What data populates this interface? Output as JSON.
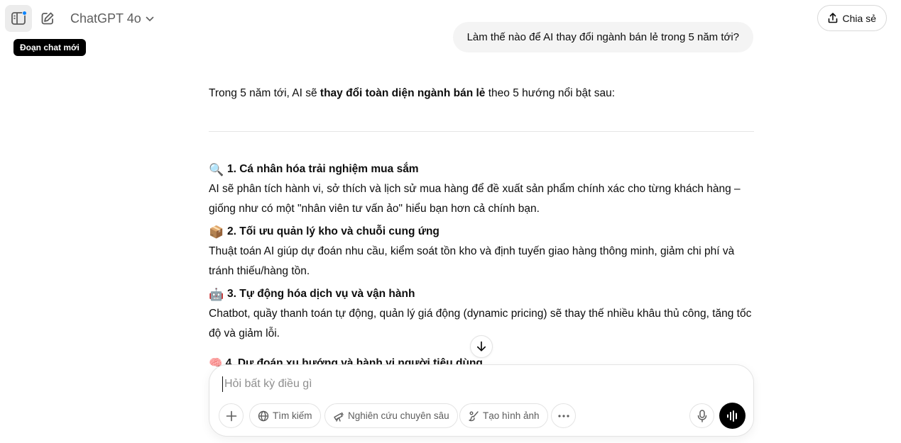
{
  "header": {
    "model_name": "ChatGPT 4o",
    "tooltip": "Đoạn chat mới",
    "share_label": "Chia sẻ"
  },
  "conversation": {
    "user_message": "Làm thế nào để AI thay đổi ngành bán lẻ trong 5 năm tới?",
    "intro_before": "Trong 5 năm tới, AI sẽ ",
    "intro_bold": "thay đổi toàn diện ngành bán lẻ",
    "intro_after": " theo 5 hướng nổi bật sau:",
    "sections": [
      {
        "icon": "🔍",
        "title": "1. Cá nhân hóa trải nghiệm mua sắm",
        "body": "AI sẽ phân tích hành vi, sở thích và lịch sử mua hàng để đề xuất sản phẩm chính xác cho từng khách hàng – giống như có một \"nhân viên tư vấn ảo\" hiểu bạn hơn cả chính bạn."
      },
      {
        "icon": "📦",
        "title": "2. Tối ưu quản lý kho và chuỗi cung ứng",
        "body": "Thuật toán AI giúp dự đoán nhu cầu, kiểm soát tồn kho và định tuyến giao hàng thông minh, giảm chi phí và tránh thiếu/hàng tồn."
      },
      {
        "icon": "🤖",
        "title": "3. Tự động hóa dịch vụ và vận hành",
        "body": "Chatbot, quầy thanh toán tự động, quản lý giá động (dynamic pricing) sẽ thay thế nhiều khâu thủ công, tăng tốc độ và giảm lỗi."
      }
    ],
    "partial_next": "🧠 4. Dự đoán xu hướng và hành vi người tiêu dùng"
  },
  "composer": {
    "placeholder": "Hỏi bất kỳ điều gì",
    "search_label": "Tìm kiếm",
    "research_label": "Nghiên cứu chuyên sâu",
    "image_label": "Tạo hình ảnh"
  }
}
